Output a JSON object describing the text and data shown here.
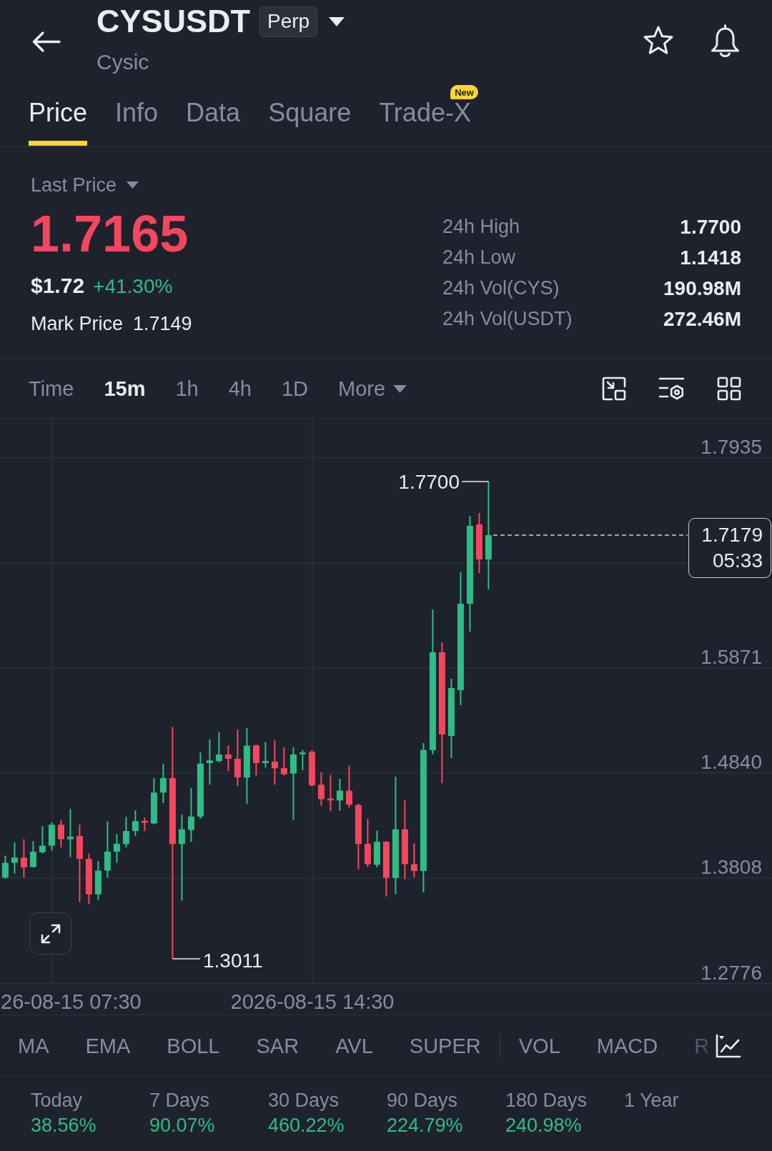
{
  "header": {
    "symbol": "CYSUSDT",
    "contract_type": "Perp",
    "name": "Cysic"
  },
  "tabs": [
    {
      "label": "Price",
      "selected": true
    },
    {
      "label": "Info",
      "selected": false
    },
    {
      "label": "Data",
      "selected": false
    },
    {
      "label": "Square",
      "selected": false
    },
    {
      "label": "Trade-X",
      "selected": false,
      "badge": "New"
    }
  ],
  "price_panel": {
    "price_type": "Last Price",
    "last_price": "1.7165",
    "usd_price": "$1.72",
    "change": "+41.30%",
    "mark_price_label": "Mark Price",
    "mark_price": "1.7149",
    "stats": [
      {
        "label": "24h High",
        "value": "1.7700"
      },
      {
        "label": "24h Low",
        "value": "1.1418"
      },
      {
        "label": "24h Vol(CYS)",
        "value": "190.98M"
      },
      {
        "label": "24h Vol(USDT)",
        "value": "272.46M"
      }
    ]
  },
  "chart_toolbar": {
    "intervals": [
      {
        "label": "Time",
        "kind": "option",
        "selected": false
      },
      {
        "label": "15m",
        "kind": "option",
        "selected": true
      },
      {
        "label": "1h",
        "kind": "option",
        "selected": false
      },
      {
        "label": "4h",
        "kind": "option",
        "selected": false
      },
      {
        "label": "1D",
        "kind": "option",
        "selected": false
      },
      {
        "label": "More",
        "kind": "dropdown",
        "selected": false
      }
    ]
  },
  "chart": {
    "y_axis": [
      "1.7935",
      "1.5871",
      "1.4840",
      "1.3808",
      "1.2776"
    ],
    "high_label": "1.7700",
    "low_label": "1.3011",
    "price_tag": {
      "price": "1.7179",
      "countdown": "05:33"
    },
    "x_axis": [
      "26-08-15 07:30",
      "2026-08-15 14:30"
    ]
  },
  "indicators": {
    "main": [
      "MA",
      "EMA",
      "BOLL",
      "SAR",
      "AVL",
      "SUPER"
    ],
    "sub": [
      "VOL",
      "MACD",
      "R"
    ]
  },
  "performance": [
    {
      "period": "Today",
      "change": "38.56%"
    },
    {
      "period": "7 Days",
      "change": "90.07%"
    },
    {
      "period": "30 Days",
      "change": "460.22%"
    },
    {
      "period": "90 Days",
      "change": "224.79%"
    },
    {
      "period": "180 Days",
      "change": "240.98%"
    },
    {
      "period": "1 Year"
    }
  ]
}
